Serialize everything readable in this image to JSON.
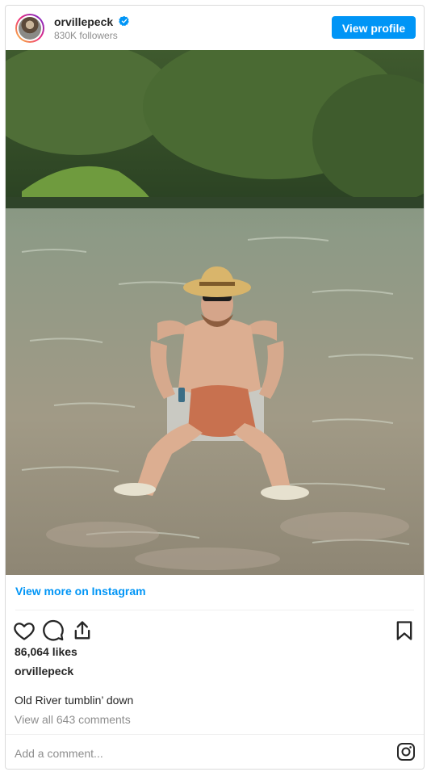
{
  "header": {
    "username": "orvillepeck",
    "verified": true,
    "followers": "830K followers",
    "view_profile_label": "View profile"
  },
  "post": {
    "image_icon": "photo",
    "view_more_label": "View more on Instagram",
    "likes": "86,064 likes",
    "owner": "orvillepeck",
    "caption": "Old River tumblin’ down",
    "comments_link": "View all 643 comments",
    "add_comment_placeholder": "Add a comment..."
  },
  "icons": [
    "heart-icon",
    "comment-icon",
    "share-icon",
    "bookmark-icon",
    "instagram-icon",
    "verified-badge-icon"
  ],
  "colors": {
    "accent": "#0095f6",
    "text": "#262626",
    "muted": "#8e8e8e",
    "border": "#dbdbdb"
  }
}
